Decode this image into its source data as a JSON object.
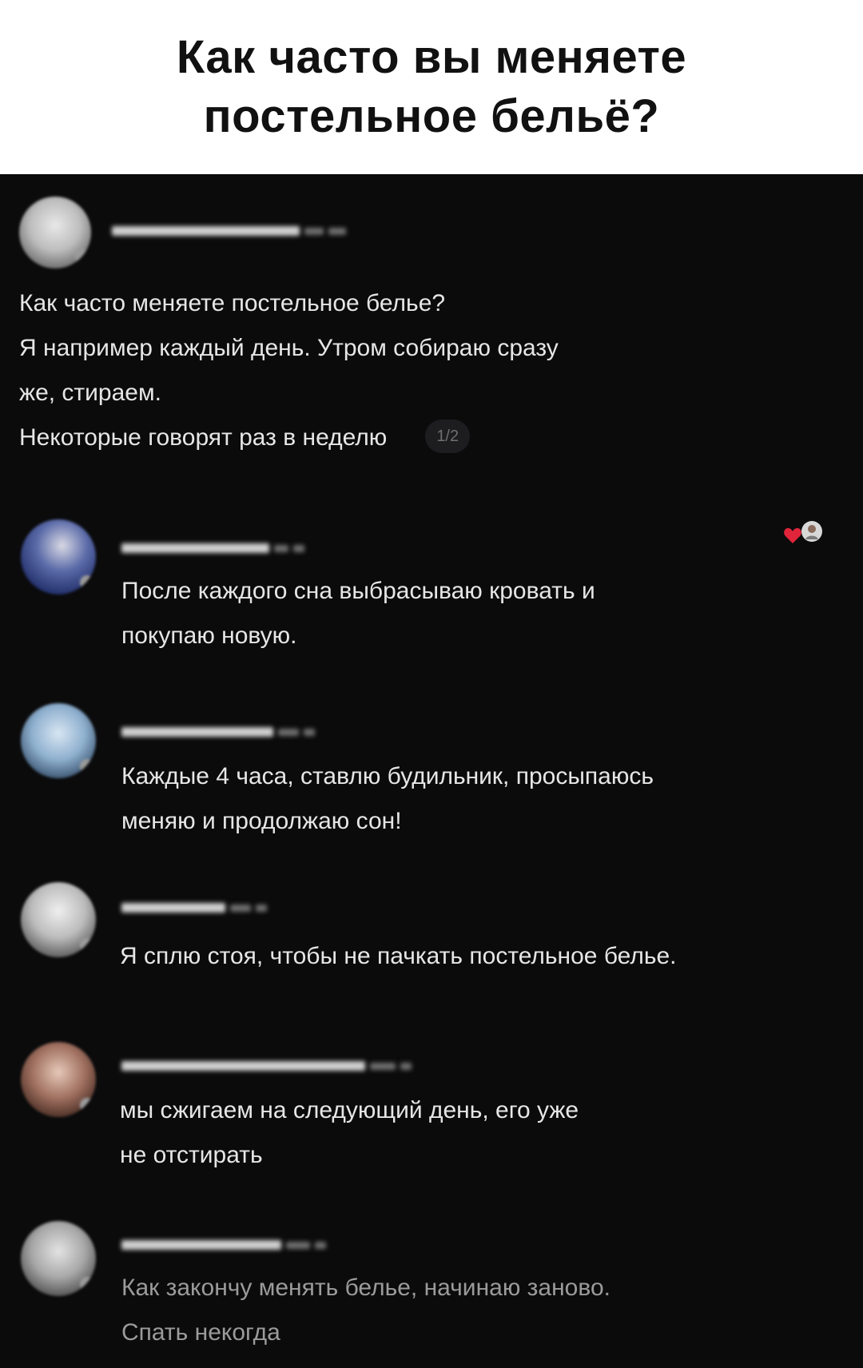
{
  "header": {
    "title": "Как часто вы меняете постельное бельё?"
  },
  "post": {
    "lines": [
      "Как часто меняете постельное белье?",
      "Я например каждый день. Утром собираю сразу",
      "же, стираем.",
      "Некоторые говорят раз в неделю"
    ],
    "page_indicator": "1/2"
  },
  "comments": [
    {
      "lines": [
        "После каждого сна выбрасываю кровать и",
        "покупаю новую."
      ]
    },
    {
      "lines": [
        "Каждые 4 часа, ставлю будильник, просыпаюсь",
        "меняю и продолжаю сон!"
      ]
    },
    {
      "lines": [
        "Я сплю стоя, чтобы не пачкать постельное белье."
      ]
    },
    {
      "lines": [
        "мы сжигаем на следующий день, его уже",
        "не отстирать"
      ]
    },
    {
      "lines": [
        "Как закончу менять белье, начинаю заново.",
        "Спать некогда"
      ]
    }
  ],
  "icons": {
    "liked_by_creator": "heart-with-avatar-icon"
  },
  "colors": {
    "background": "#0b0b0c",
    "text": "#e6e6e6",
    "heart": "#e0243a"
  }
}
